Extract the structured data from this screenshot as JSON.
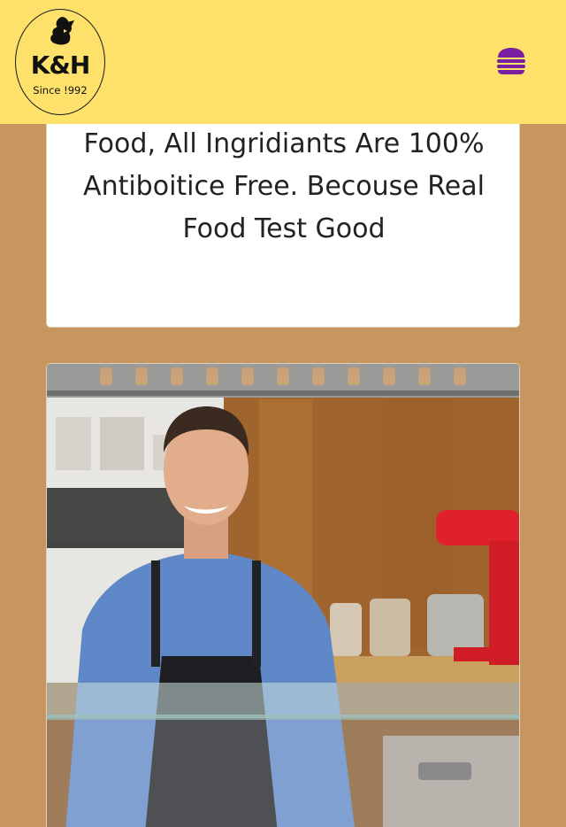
{
  "header": {
    "logo": {
      "main_text": "K&H",
      "sub_text": "Since !992",
      "icon": "rooster-icon"
    },
    "menu_icon": "hamburger-menu-icon",
    "menu_color": "#7b1fa2",
    "background": "#fde16b"
  },
  "about": {
    "text": "Food, All Ingridiants Are 100% Antiboitice Free. Becouse Real Food Test Good"
  },
  "photo": {
    "subject": "chef-photo",
    "description_icon": "chef-in-kitchen-image"
  },
  "colors": {
    "page_background": "#c9955f",
    "card_background": "#ffffff"
  }
}
